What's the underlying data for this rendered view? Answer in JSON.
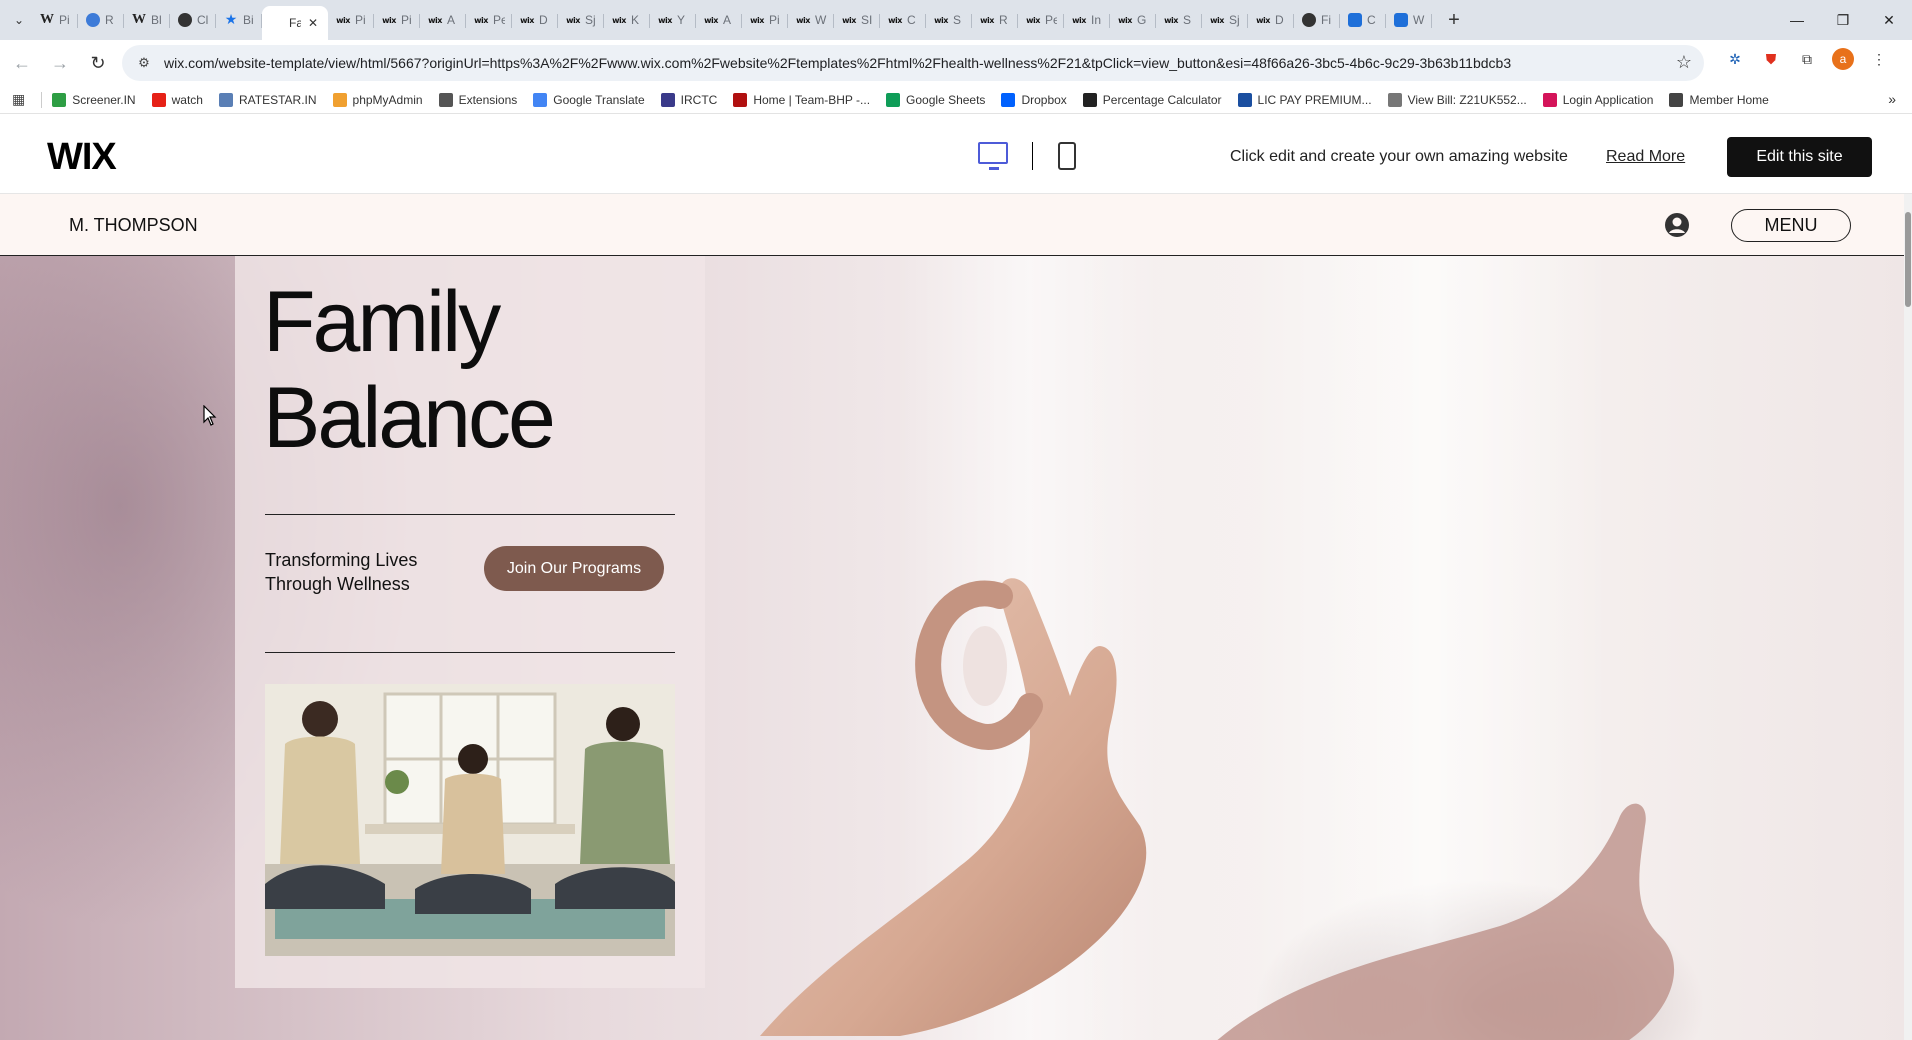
{
  "browser": {
    "tabs": [
      {
        "icon": "W",
        "title": "Pi",
        "kind": "w"
      },
      {
        "icon": "",
        "title": "R",
        "kind": "globe"
      },
      {
        "icon": "W",
        "title": "Bl",
        "kind": "w"
      },
      {
        "icon": "",
        "title": "Cl",
        "kind": "dark"
      },
      {
        "icon": "★",
        "title": "Bi",
        "kind": "star"
      },
      {
        "icon": "",
        "title": "Fa",
        "kind": "wix",
        "active": true
      },
      {
        "icon": "wix",
        "title": "Pi",
        "kind": "wix"
      },
      {
        "icon": "wix",
        "title": "Pi",
        "kind": "wix"
      },
      {
        "icon": "wix",
        "title": "A",
        "kind": "wix"
      },
      {
        "icon": "wix",
        "title": "Pe",
        "kind": "wix"
      },
      {
        "icon": "wix",
        "title": "D",
        "kind": "wix"
      },
      {
        "icon": "wix",
        "title": "Sj",
        "kind": "wix"
      },
      {
        "icon": "wix",
        "title": "K",
        "kind": "wix"
      },
      {
        "icon": "wix",
        "title": "Y",
        "kind": "wix"
      },
      {
        "icon": "wix",
        "title": "A",
        "kind": "wix"
      },
      {
        "icon": "wix",
        "title": "Pi",
        "kind": "wix"
      },
      {
        "icon": "wix",
        "title": "W",
        "kind": "wix"
      },
      {
        "icon": "wix",
        "title": "SI",
        "kind": "wix"
      },
      {
        "icon": "wix",
        "title": "C",
        "kind": "wix"
      },
      {
        "icon": "wix",
        "title": "S",
        "kind": "wix"
      },
      {
        "icon": "wix",
        "title": "R",
        "kind": "wix"
      },
      {
        "icon": "wix",
        "title": "Pe",
        "kind": "wix"
      },
      {
        "icon": "wix",
        "title": "In",
        "kind": "wix"
      },
      {
        "icon": "wix",
        "title": "G",
        "kind": "wix"
      },
      {
        "icon": "wix",
        "title": "S",
        "kind": "wix"
      },
      {
        "icon": "wix",
        "title": "Sj",
        "kind": "wix"
      },
      {
        "icon": "wix",
        "title": "D",
        "kind": "wix"
      },
      {
        "icon": "",
        "title": "Fi",
        "kind": "dark"
      },
      {
        "icon": "",
        "title": "C",
        "kind": "blue"
      },
      {
        "icon": "",
        "title": "W",
        "kind": "blue"
      }
    ],
    "url": "wix.com/website-template/view/html/5667?originUrl=https%3A%2F%2Fwww.wix.com%2Fwebsite%2Ftemplates%2Fhtml%2Fhealth-wellness%2F21&tpClick=view_button&esi=48f66a26-3bc5-4b6c-9c29-3b63b11bdcb3",
    "profile_initial": "a",
    "bookmarks": [
      {
        "label": "Screener.IN",
        "color": "#2e9e44"
      },
      {
        "label": "watch",
        "color": "#e62117"
      },
      {
        "label": "RATESTAR.IN",
        "color": "#5a7fb5"
      },
      {
        "label": "phpMyAdmin",
        "color": "#f0a030"
      },
      {
        "label": "Extensions",
        "color": "#555555"
      },
      {
        "label": "Google Translate",
        "color": "#4285f4"
      },
      {
        "label": "IRCTC",
        "color": "#3a3a8a"
      },
      {
        "label": "Home | Team-BHP -...",
        "color": "#b01010"
      },
      {
        "label": "Google Sheets",
        "color": "#0f9d58"
      },
      {
        "label": "Dropbox",
        "color": "#0061fe"
      },
      {
        "label": "Percentage Calculator",
        "color": "#222222"
      },
      {
        "label": "LIC PAY PREMIUM...",
        "color": "#1b4fa0"
      },
      {
        "label": "View Bill: Z21UK552...",
        "color": "#777777"
      },
      {
        "label": "Login Application",
        "color": "#d4145a"
      },
      {
        "label": "Member Home",
        "color": "#444444"
      }
    ]
  },
  "wix_bar": {
    "logo": "WIX",
    "message": "Click edit and create your own amazing website",
    "read_more": "Read More",
    "edit_button": "Edit this site"
  },
  "site": {
    "brand": "M. THOMPSON",
    "menu_label": "MENU",
    "hero": {
      "title_line1": "Family",
      "title_line2": "Balance",
      "tagline": "Transforming Lives Through Wellness",
      "cta": "Join Our Programs"
    }
  },
  "colors": {
    "cta_bg": "#7e5a4e",
    "header_bg": "#fdf6f3",
    "device_active": "#4d5bd8"
  }
}
